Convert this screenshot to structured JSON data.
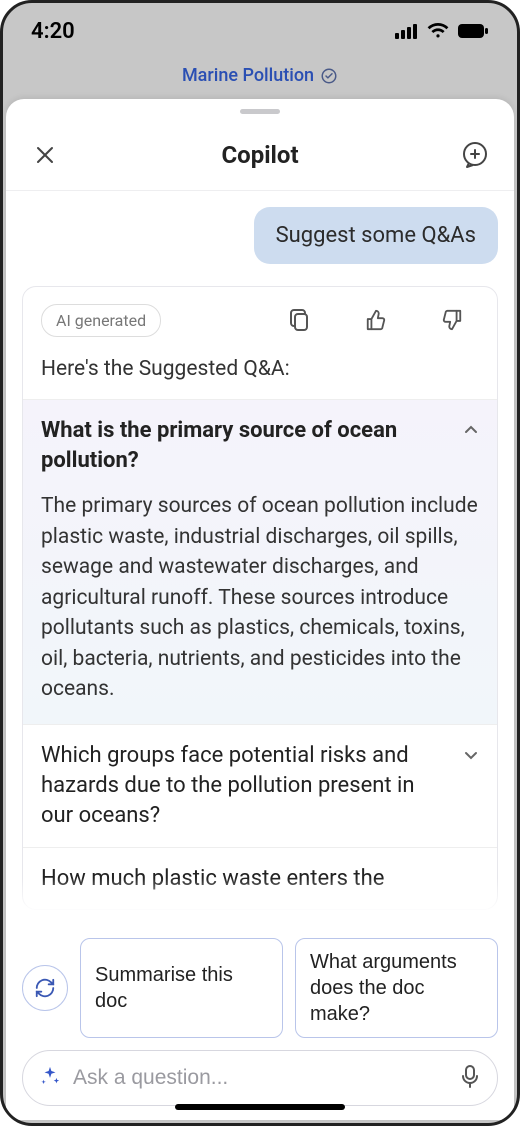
{
  "statusbar": {
    "time": "4:20"
  },
  "doc": {
    "title": "Marine Pollution"
  },
  "sheet": {
    "title": "Copilot"
  },
  "conversation": {
    "user_message": "Suggest some Q&As",
    "ai_badge": "AI generated",
    "intro": "Here's the Suggested Q&A:",
    "qa": [
      {
        "question": "What is the primary source of ocean pollution?",
        "answer": "The primary sources of ocean pollution include plastic waste, industrial discharges, oil spills, sewage and wastewater discharges, and agricultural runoff. These sources introduce pollutants such as plastics, chemicals, toxins, oil, bacteria, nutrients, and pesticides into the oceans.",
        "expanded": true
      },
      {
        "question": "Which groups face potential risks and hazards due to the pollution present in our oceans?",
        "expanded": false
      },
      {
        "question": "How much plastic waste enters the",
        "expanded": false
      }
    ]
  },
  "suggestions": {
    "chip_1": "Summarise this doc",
    "chip_2": "What arguments does the doc make?"
  },
  "input": {
    "placeholder": "Ask a question..."
  },
  "icons": {
    "close": "close-icon",
    "new_chat": "plus-chat-icon",
    "copy": "copy-icon",
    "thumbs_up": "thumbs-up-icon",
    "thumbs_down": "thumbs-down-icon",
    "refresh": "refresh-icon",
    "sparkle": "sparkle-icon",
    "mic": "mic-icon",
    "sync": "cloud-sync-icon"
  }
}
